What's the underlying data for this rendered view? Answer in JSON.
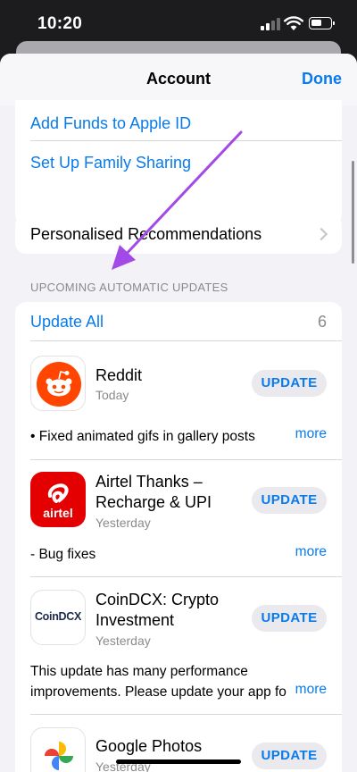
{
  "status_bar": {
    "time": "10:20"
  },
  "nav": {
    "title": "Account",
    "done": "Done"
  },
  "account_links": [
    {
      "label": "Add Funds to Apple ID"
    },
    {
      "label": "Set Up Family Sharing"
    }
  ],
  "recommendations": {
    "label": "Personalised Recommendations"
  },
  "updates": {
    "section_header": "UPCOMING AUTOMATIC UPDATES",
    "update_all": "Update All",
    "count": "6",
    "update_label": "UPDATE",
    "more_label": "more",
    "apps": [
      {
        "name_line1": "Reddit",
        "name_line2": "",
        "date": "Today",
        "notes_line1": "• Fixed animated gifs in gallery posts",
        "notes_line2": ""
      },
      {
        "name_line1": "Airtel Thanks –",
        "name_line2": "Recharge & UPI",
        "date": "Yesterday",
        "notes_line1": "- Bug fixes",
        "notes_line2": "",
        "icon_text": "airtel"
      },
      {
        "name_line1": "CoinDCX: Crypto",
        "name_line2": "Investment",
        "date": "Yesterday",
        "notes_line1": "This update has many performance",
        "notes_line2": "improvements. Please update your app fo",
        "icon_text": "CoinDCX"
      },
      {
        "name_line1": "Google Photos",
        "name_line2": "",
        "date": "Yesterday"
      }
    ]
  },
  "colors": {
    "accent": "#0a7bea",
    "annotation_arrow": "#a349e8",
    "reddit": "#ff4500",
    "airtel": "#e40000"
  }
}
